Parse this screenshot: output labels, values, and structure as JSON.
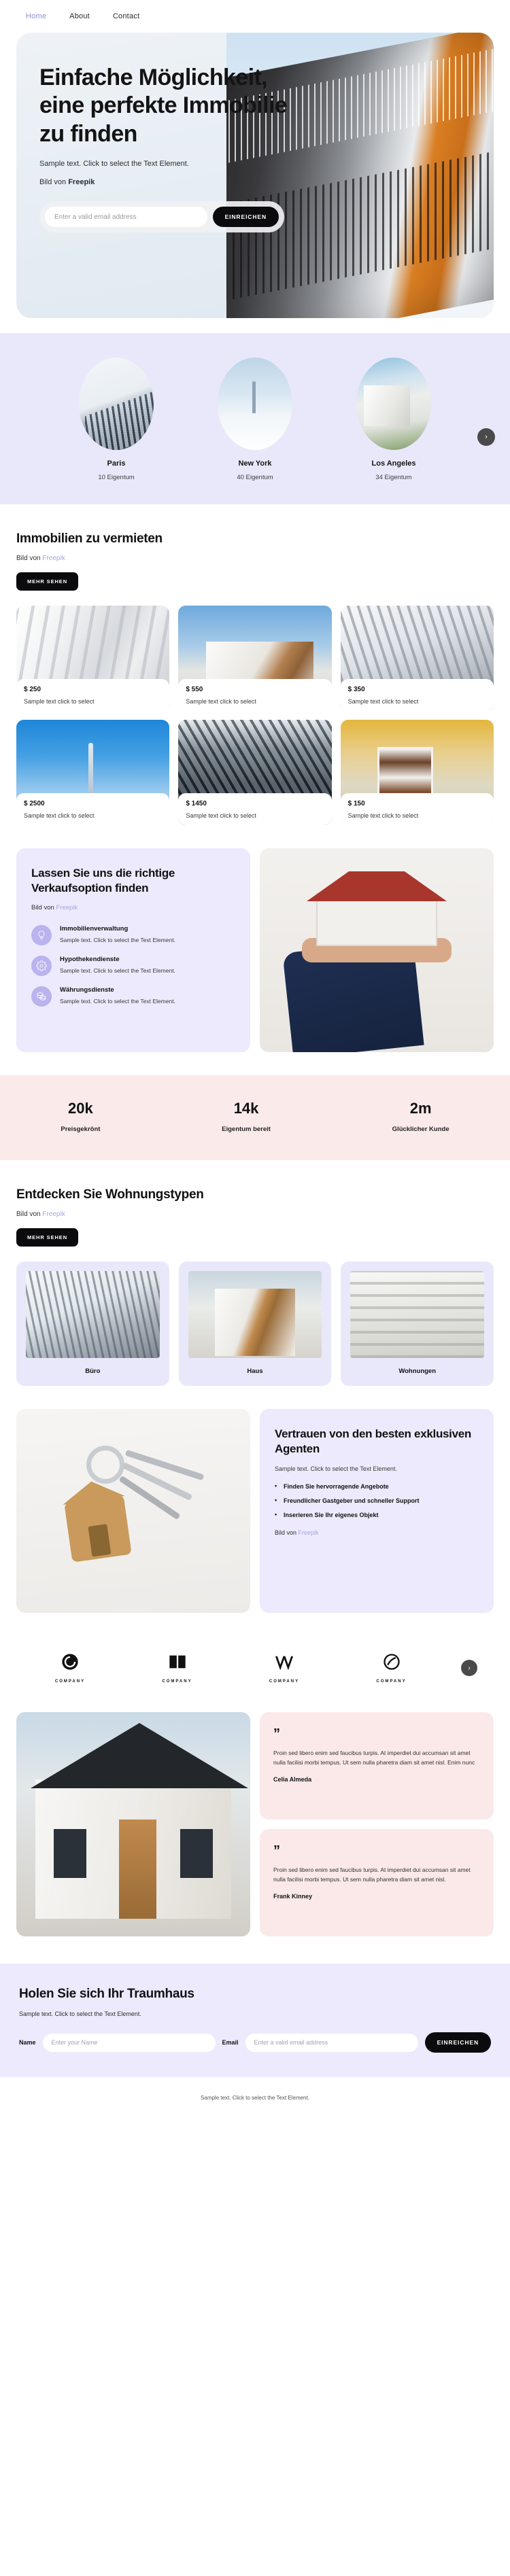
{
  "nav": {
    "items": [
      {
        "label": "Home",
        "active": true
      },
      {
        "label": "About",
        "active": false
      },
      {
        "label": "Contact",
        "active": false
      }
    ]
  },
  "hero": {
    "heading": "Einfache Möglichkeit, eine perfekte Immobilie zu finden",
    "subtitle": "Sample text. Click to select the Text Element.",
    "credit_prefix": "Bild von ",
    "credit_source": "Freepik",
    "email_placeholder": "Enter a valid email address",
    "submit_label": "EINREICHEN"
  },
  "cities": {
    "items": [
      {
        "name": "Paris",
        "count": "10 Eigentum"
      },
      {
        "name": "New York",
        "count": "40 Eigentum"
      },
      {
        "name": "Los Angeles",
        "count": "34 Eigentum"
      }
    ],
    "next_label": "›"
  },
  "rent": {
    "title": "Immobilien zu vermieten",
    "credit_prefix": "Bild von ",
    "credit_source": "Freepik",
    "button_label": "MEHR SEHEN",
    "properties": [
      {
        "price": "$ 250",
        "desc": "Sample text click to select"
      },
      {
        "price": "$ 550",
        "desc": "Sample text click to select"
      },
      {
        "price": "$ 350",
        "desc": "Sample text click to select"
      },
      {
        "price": "$ 2500",
        "desc": "Sample text click to select"
      },
      {
        "price": "$ 1450",
        "desc": "Sample text click to select"
      },
      {
        "price": "$ 150",
        "desc": "Sample text click to select"
      }
    ]
  },
  "services": {
    "heading": "Lassen Sie uns die richtige Verkaufsoption finden",
    "credit_prefix": "Bild von ",
    "credit_source": "Freepik",
    "items": [
      {
        "icon": "lightbulb-icon",
        "name": "Immobilienverwaltung",
        "text": "Sample text. Click to select the Text Element."
      },
      {
        "icon": "gear-icon",
        "name": "Hypothekendienste",
        "text": "Sample text. Click to select the Text Element."
      },
      {
        "icon": "coins-icon",
        "name": "Währungsdienste",
        "text": "Sample text. Click to select the Text Element."
      }
    ]
  },
  "stats": {
    "items": [
      {
        "value": "20k",
        "label": "Preisgekrönt"
      },
      {
        "value": "14k",
        "label": "Eigentum bereit"
      },
      {
        "value": "2m",
        "label": "Glücklicher Kunde"
      }
    ]
  },
  "types": {
    "title": "Entdecken Sie Wohnungstypen",
    "credit_prefix": "Bild von ",
    "credit_source": "Freepik",
    "button_label": "MEHR SEHEN",
    "items": [
      {
        "label": "Büro"
      },
      {
        "label": "Haus"
      },
      {
        "label": "Wohnungen"
      }
    ]
  },
  "agents": {
    "heading": "Vertrauen von den besten exklusiven Agenten",
    "subtitle": "Sample text. Click to select the Text Element.",
    "bullets": [
      "Finden Sie hervorragende Angebote",
      "Freundlicher Gastgeber und schneller Support",
      "Inserieren Sie Ihr eigenes Objekt"
    ],
    "credit_prefix": "Bild von ",
    "credit_source": "Freepik"
  },
  "brands": {
    "items": [
      {
        "icon": "spiral-logo-icon",
        "name": "COMPANY"
      },
      {
        "icon": "book-logo-icon",
        "name": "COMPANY"
      },
      {
        "icon": "chevrons-logo-icon",
        "name": "COMPANY"
      },
      {
        "icon": "leaf-circle-logo-icon",
        "name": "COMPANY"
      }
    ],
    "next_label": "›"
  },
  "testimonials": {
    "items": [
      {
        "quote": "”",
        "text": "Proin sed libero enim sed faucibus turpis. At imperdiet dui accumsan sit amet nulla facilisi morbi tempus. Ut sem nulla pharetra diam sit amet nisl. Enim nunc",
        "author": "Celia Almeda"
      },
      {
        "quote": "”",
        "text": "Proin sed libero enim sed faucibus turpis. At imperdiet dui accumsan sit amet nulla facilisi morbi tempus. Ut sem nulla pharetra diam sit amet nisl.",
        "author": "Frank Kinney"
      }
    ]
  },
  "cta": {
    "heading": "Holen Sie sich Ihr Traumhaus",
    "subtitle": "Sample text. Click to select the Text Element.",
    "name_label": "Name",
    "name_placeholder": "Enter your Name",
    "email_label": "Email",
    "email_placeholder": "Enter a valid email address",
    "submit_label": "EINREICHEN"
  },
  "footer": {
    "text": "Sample text. Click to select the Text Element."
  },
  "colors": {
    "lavender": "#e9e8fb",
    "lavender_card": "#eceafc",
    "pink": "#fbeaea",
    "accent_link": "#a5a7e0",
    "dark": "#0b0b0d"
  }
}
